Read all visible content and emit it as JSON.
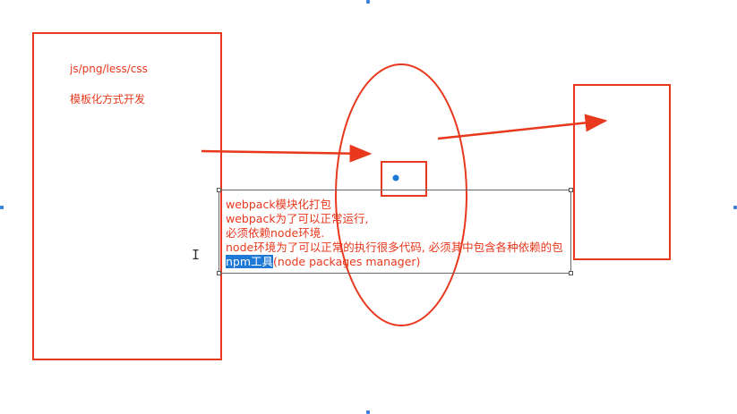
{
  "left_box": {
    "line1": "js/png/less/css",
    "line2": "模板化方式开发"
  },
  "note": {
    "lines": [
      "webpack模块化打包",
      "webpack为了可以正常运行,",
      "必须依赖node环境.",
      "node环境为了可以正常的执行很多代码, 必须其中包含各种依赖的包"
    ],
    "last_highlight": "npm工具",
    "last_rest": "(node packages manager)"
  },
  "colors": {
    "shape": "#e8381d",
    "dot": "#1e78d6",
    "highlight": "#1e78d6"
  }
}
